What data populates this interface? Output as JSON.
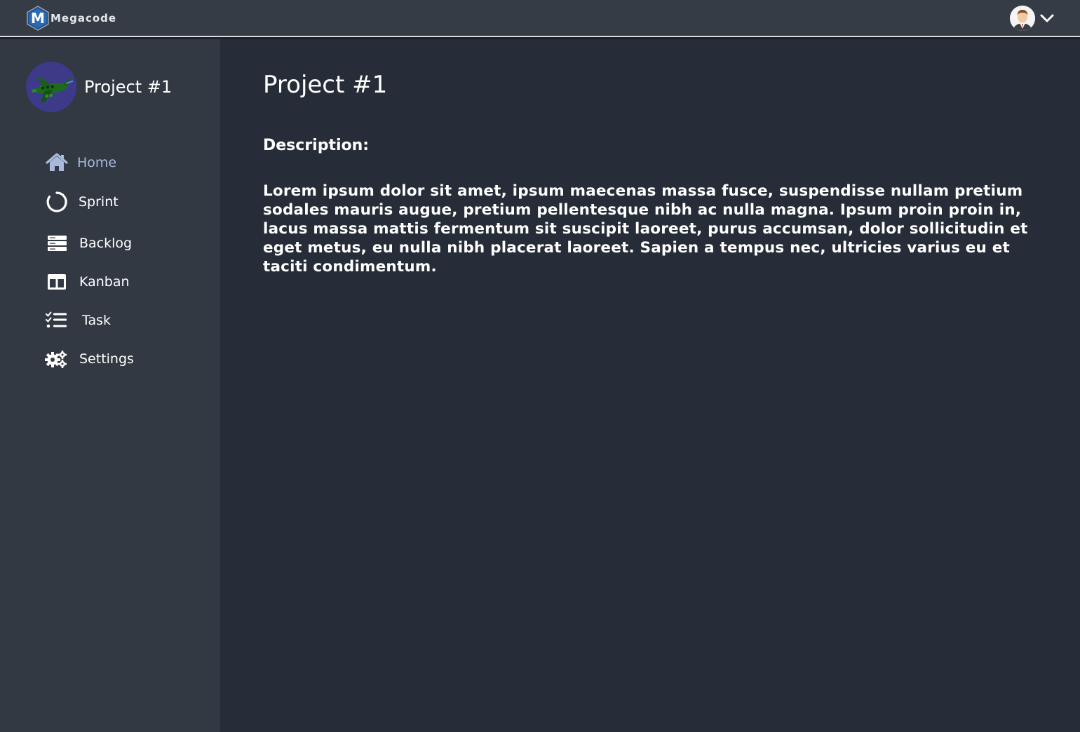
{
  "header": {
    "brand_name": "Megacode",
    "logo_letter": "M",
    "logo_icon": "megacode-logo-icon",
    "user_avatar_icon": "user-avatar-icon",
    "user_menu_icon": "chevron-down-icon"
  },
  "sidebar": {
    "project_name": "Project #1",
    "project_avatar_icon": "airplane-icon",
    "items": [
      {
        "label": "Home",
        "icon": "home-icon",
        "active": true
      },
      {
        "label": "Sprint",
        "icon": "sprint-circle-icon",
        "active": false
      },
      {
        "label": "Backlog",
        "icon": "backlog-icon",
        "active": false
      },
      {
        "label": "Kanban",
        "icon": "kanban-icon",
        "active": false
      },
      {
        "label": "Task",
        "icon": "task-list-icon",
        "active": false
      },
      {
        "label": "Settings",
        "icon": "gears-icon",
        "active": false
      }
    ]
  },
  "main": {
    "title": "Project #1",
    "description_label": "Description:",
    "description_text": "Lorem ipsum dolor sit amet, ipsum maecenas massa fusce, suspendisse nullam pretium sodales mauris augue, pretium pellentesque nibh ac nulla magna. Ipsum proin proin in, lacus massa mattis fermentum sit suscipit laoreet, purus accumsan, dolor sollicitudin et eget metus, eu nulla nibh placerat laoreet. Sapien a tempus nec, ultricies varius eu et taciti condimentum."
  },
  "colors": {
    "topbar_bg": "#353c46",
    "sidebar_bg": "#323943",
    "main_bg": "#262d38",
    "active_nav": "#a8b9dc",
    "project_avatar_bg": "#3d3a8a"
  }
}
